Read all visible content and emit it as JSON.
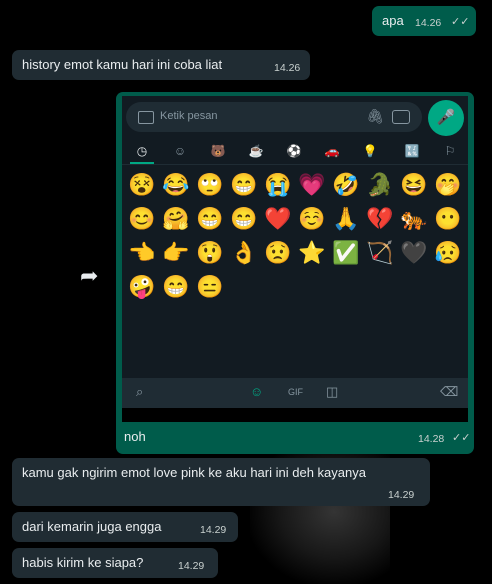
{
  "messages": {
    "m1": {
      "text": "apa",
      "time": "14.26",
      "ticks": "✓✓"
    },
    "m2": {
      "text": "history emot kamu hari ini coba liat",
      "time": "14.26"
    },
    "m3": {
      "caption": "noh",
      "time": "14.28",
      "ticks": "✓✓"
    },
    "m4": {
      "text": "kamu gak ngirim emot love pink ke aku hari ini deh kayanya",
      "time": "14.29"
    },
    "m5": {
      "text": "dari kemarin juga engga",
      "time": "14.29"
    },
    "m6": {
      "text": "habis kirim ke siapa?",
      "time": "14.29"
    }
  },
  "screenshot": {
    "placeholder": "Ketik pesan",
    "emojis": [
      "😵",
      "😂",
      "🙄",
      "😁",
      "😭",
      "💗",
      "🤣",
      "🐊",
      "😆",
      "🤭",
      "😊",
      "🤗",
      "😁",
      "😁",
      "❤️",
      "☺️",
      "🙏",
      "💔",
      "🐅",
      "😶",
      "👈",
      "👉",
      "😲",
      "👌",
      "😟",
      "⭐",
      "✅",
      "🏹",
      "🖤",
      "😥",
      "🤪",
      "😁",
      "😑"
    ]
  },
  "icons": {
    "forward": "forward-arrow-icon",
    "mic": "microphone-icon",
    "accent": "#00a884",
    "outgoing_bubble": "#005c4b",
    "incoming_bubble": "#202c33"
  }
}
